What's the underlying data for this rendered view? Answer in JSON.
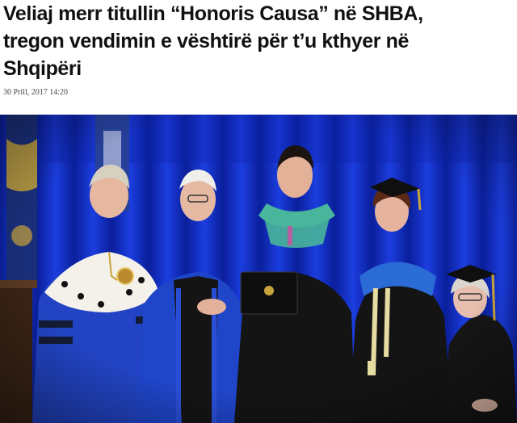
{
  "article": {
    "headline_lines": [
      "Veliaj merr titullin “Honoris Causa” në SHBA,",
      "tregon vendimin e vështirë për t’u kthyer në",
      "Shqipëri"
    ],
    "date": "30 Prill, 2017 14:20"
  },
  "photo": {
    "description_hidden": true
  },
  "colors": {
    "background": "#ffffff",
    "headline": "#111111",
    "date": "#444444",
    "curtain": "#1530c8",
    "gown_blue": "#1f45c9",
    "gown_black": "#141414",
    "hood_green": "#49b59a",
    "ermine": "#f4f1ea",
    "gold": "#c9a43a"
  }
}
